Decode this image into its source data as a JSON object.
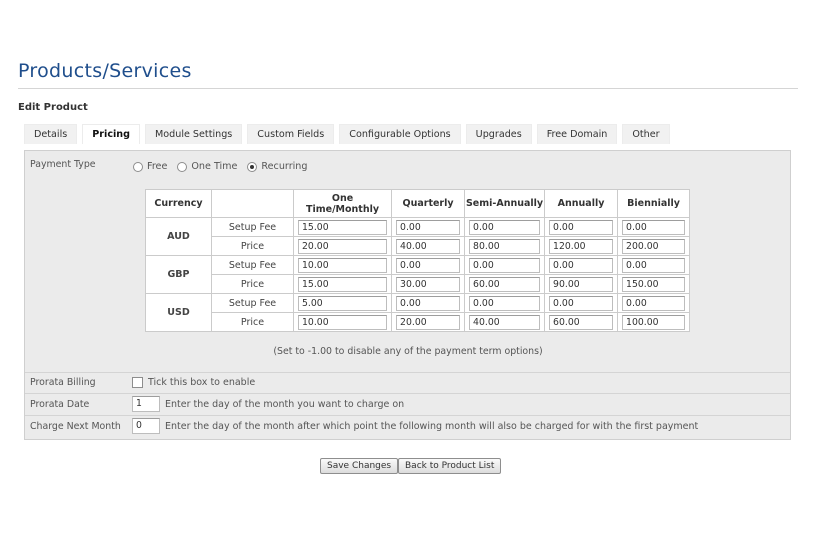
{
  "page": {
    "title": "Products/Services",
    "section_title": "Edit Product"
  },
  "tabs": [
    {
      "label": "Details"
    },
    {
      "label": "Pricing",
      "active": true
    },
    {
      "label": "Module Settings"
    },
    {
      "label": "Custom Fields"
    },
    {
      "label": "Configurable Options"
    },
    {
      "label": "Upgrades"
    },
    {
      "label": "Free Domain"
    },
    {
      "label": "Other"
    }
  ],
  "payment_type": {
    "label": "Payment Type",
    "options": [
      "Free",
      "One Time",
      "Recurring"
    ],
    "selected": "Recurring"
  },
  "pricing_table": {
    "headers": [
      "Currency",
      "",
      "One Time/Monthly",
      "Quarterly",
      "Semi-Annually",
      "Annually",
      "Biennially"
    ],
    "currencies": [
      {
        "code": "AUD",
        "rows": [
          {
            "type": "Setup Fee",
            "values": [
              "15.00",
              "0.00",
              "0.00",
              "0.00",
              "0.00"
            ]
          },
          {
            "type": "Price",
            "values": [
              "20.00",
              "40.00",
              "80.00",
              "120.00",
              "200.00"
            ]
          }
        ]
      },
      {
        "code": "GBP",
        "rows": [
          {
            "type": "Setup Fee",
            "values": [
              "10.00",
              "0.00",
              "0.00",
              "0.00",
              "0.00"
            ]
          },
          {
            "type": "Price",
            "values": [
              "15.00",
              "30.00",
              "60.00",
              "90.00",
              "150.00"
            ]
          }
        ]
      },
      {
        "code": "USD",
        "rows": [
          {
            "type": "Setup Fee",
            "values": [
              "5.00",
              "0.00",
              "0.00",
              "0.00",
              "0.00"
            ]
          },
          {
            "type": "Price",
            "values": [
              "10.00",
              "20.00",
              "40.00",
              "60.00",
              "100.00"
            ]
          }
        ]
      }
    ],
    "note": "(Set to -1.00 to disable any of the payment term options)"
  },
  "prorata_billing": {
    "label": "Prorata Billing",
    "checkbox_label": "Tick this box to enable",
    "checked": false
  },
  "prorata_date": {
    "label": "Prorata Date",
    "value": "1",
    "help": "Enter the day of the month you want to charge on"
  },
  "charge_next_month": {
    "label": "Charge Next Month",
    "value": "0",
    "help": "Enter the day of the month after which point the following month will also be charged for with the first payment"
  },
  "buttons": {
    "save": "Save Changes",
    "back": "Back to Product List"
  }
}
